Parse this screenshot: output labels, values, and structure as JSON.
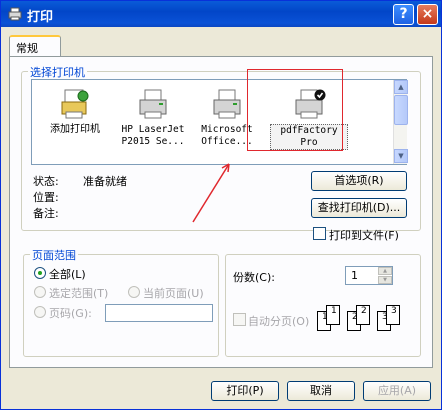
{
  "window": {
    "title": "打印",
    "help_btn": "?",
    "close_btn": "×"
  },
  "tabs": [
    {
      "label": "常规"
    }
  ],
  "printer_select": {
    "legend": "选择打印机",
    "printers": [
      {
        "label_line1": "添加打印机",
        "label_line2": ""
      },
      {
        "label_line1": "HP LaserJet",
        "label_line2": "P2015 Se..."
      },
      {
        "label_line1": "Microsoft",
        "label_line2": "Office..."
      },
      {
        "label_line1": "pdfFactory",
        "label_line2": "Pro"
      }
    ],
    "status_label": "状态:",
    "status_value": "准备就绪",
    "location_label": "位置:",
    "comment_label": "备注:",
    "preferences_btn": "首选项(R)",
    "find_printer_btn": "查找打印机(D)...",
    "print_to_file": "打印到文件(F)"
  },
  "page_range": {
    "legend": "页面范围",
    "all": "全部(L)",
    "selection": "选定范围(T)",
    "current_page": "当前页面(U)",
    "pages": "页码(G):",
    "pages_value": ""
  },
  "copies": {
    "label": "份数(C):",
    "value": "1",
    "collate": "自动分页(O)",
    "page_numbers": [
      "1",
      "1",
      "2",
      "2",
      "3",
      "3"
    ]
  },
  "buttons": {
    "print": "打印(P)",
    "cancel": "取消",
    "apply": "应用(A)"
  },
  "colors": {
    "titlebar": "#0a52d6",
    "legend_text": "#0046d5",
    "highlight_box": "#e0282e",
    "face": "#ece9d8"
  }
}
